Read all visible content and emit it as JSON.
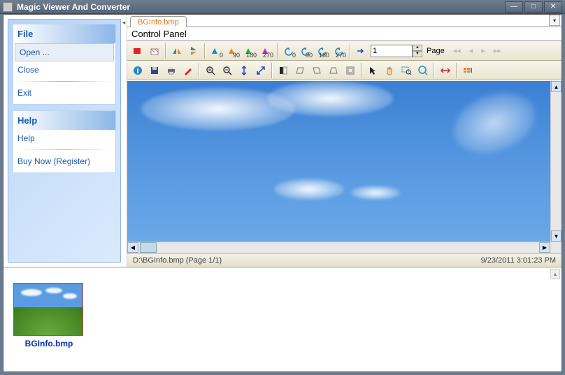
{
  "window": {
    "title": "Magic Viewer And Converter"
  },
  "sidebar": {
    "sections": [
      {
        "header": "File",
        "items": [
          "Open ...",
          "Close",
          "Exit"
        ]
      },
      {
        "header": "Help",
        "items": [
          "Help",
          "Buy Now (Register)"
        ]
      }
    ]
  },
  "tabs": {
    "active": "BGInfo.bmp"
  },
  "controlPanel": {
    "label": "Control Panel"
  },
  "toolbar1": {
    "page_spinner_value": "1",
    "page_label": "Page",
    "rotations": [
      "0",
      "90",
      "180",
      "270"
    ]
  },
  "status": {
    "left": "D:\\BGInfo.bmp   (Page 1/1)",
    "right": "9/23/2011 3:01:23 PM"
  },
  "thumbnails": [
    {
      "label": "BGInfo.bmp"
    }
  ]
}
